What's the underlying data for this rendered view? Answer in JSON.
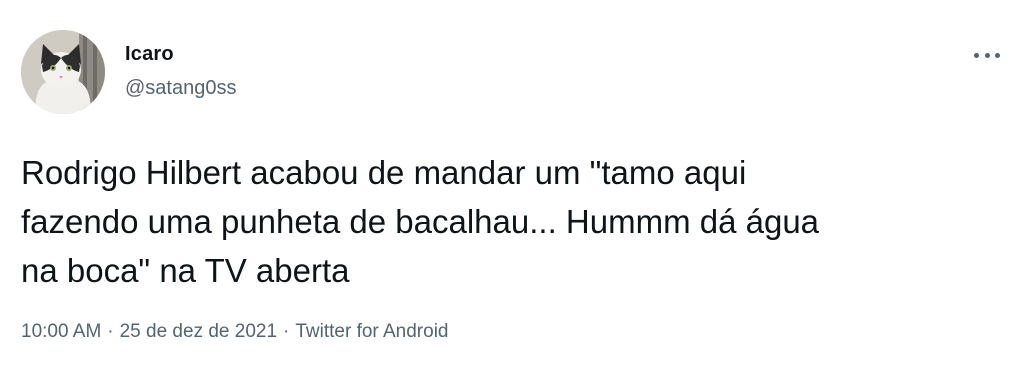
{
  "tweet": {
    "display_name": "Icaro",
    "handle": "@satang0ss",
    "text": "Rodrigo Hilbert acabou de mandar um \"tamo aqui\nfazendo uma punheta de bacalhau... Hummm dá água\nna boca\" na TV aberta",
    "time": "10:00 AM",
    "separator": "·",
    "date": "25 de dez de 2021",
    "source": "Twitter for Android"
  },
  "icons": {
    "avatar": "cat-avatar",
    "more": "more-options-icon"
  },
  "colors": {
    "text": "#0f1419",
    "secondary": "#536471",
    "background": "#ffffff"
  }
}
